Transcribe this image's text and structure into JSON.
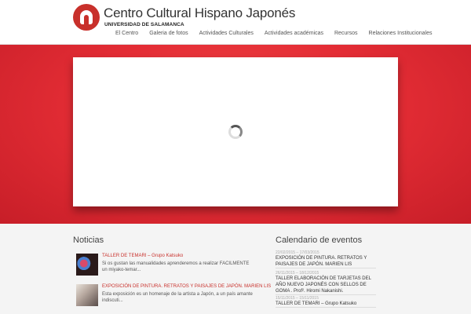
{
  "header": {
    "title": "Centro Cultural Hispano Japonés",
    "subtitle": "UNIVERSIDAD DE SALAMANCA"
  },
  "nav": {
    "items": [
      "El Centro",
      "Galeria de fotos",
      "Actividades Culturales",
      "Actividades académicas",
      "Recursos",
      "Relaciones Institucionales"
    ]
  },
  "news": {
    "title": "Noticias",
    "items": [
      {
        "headline": "TALLER DE TEMARI – Grupo Katsuko",
        "text": "Si os gustan las manualidades aprenderemos a realizar FACILMENTE un miyako-temar..."
      },
      {
        "headline": "EXPOSICIÓN DE PINTURA. RETRATOS Y PAISAJES DE JAPÓN. MARIEN LIS",
        "text": "Esta exposición es un homenaje de la artista a Japón, a un país amante indiscuti..."
      }
    ]
  },
  "calendar": {
    "title": "Calendario de eventos",
    "items": [
      {
        "date": "22/02/2015 – 17/03/2015",
        "text": "EXPOSICIÓN DE PINTURA. RETRATOS Y PAISAJES DE JAPÓN. MARIEN LIS"
      },
      {
        "date": "26/11/2015 – 18/12/2015",
        "text": "TALLER ELABORACIÓN DE TARJETAS DEL AÑO NUEVO JAPONÉS CON SELLOS DE GOMA . Prof². Hiromi Nakanishi."
      },
      {
        "date": "15/11/2015 – 15/11/2015",
        "text": "TALLER DE TEMARI – Grupo Katsuko"
      }
    ]
  },
  "colors": {
    "brand_red": "#c8302b",
    "band_red": "#e42d35"
  }
}
